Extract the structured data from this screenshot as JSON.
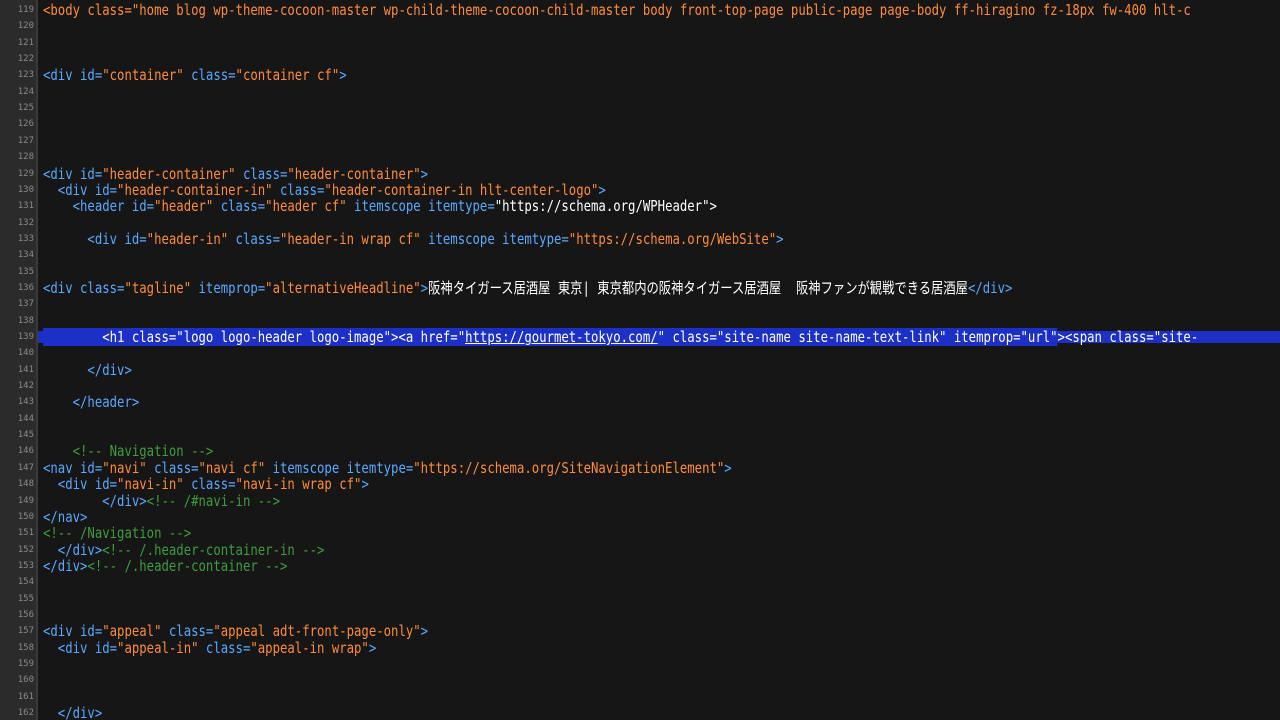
{
  "editor": {
    "line_numbers": [
      "119",
      "120",
      "121",
      "122",
      "123",
      "124",
      "125",
      "126",
      "127",
      "128",
      "129",
      "130",
      "131",
      "132",
      "133",
      "134",
      "135",
      "136",
      "137",
      "138",
      "139",
      "140",
      "141",
      "142",
      "143",
      "144",
      "145",
      "146",
      "147",
      "148",
      "149",
      "150",
      "151",
      "152",
      "153",
      "154",
      "155",
      "156",
      "157",
      "158",
      "159",
      "160",
      "161",
      "162"
    ],
    "lines": {
      "l119": "<body class=\"home blog wp-theme-cocoon-master wp-child-theme-cocoon-child-master body front-top-page public-page page-body ff-hiragino fz-18px fw-400 hlt-c",
      "l123": "<div id=\"container\" class=\"container cf\">",
      "l129": "<div id=\"header-container\" class=\"header-container\">",
      "l130": "  <div id=\"header-container-in\" class=\"header-container-in hlt-center-logo\">",
      "l131": "    <header id=\"header\" class=\"header cf\" itemscope itemtype=\"https://schema.org/WPHeader\">",
      "l133": "      <div id=\"header-in\" class=\"header-in wrap cf\" itemscope itemtype=\"https://schema.org/WebSite\">",
      "l136": "<div class=\"tagline\" itemprop=\"alternativeHeadline\">阪神タイガース居酒屋 東京| 東京都内の阪神タイガース居酒屋  阪神ファンが観戦できる居酒屋</div>",
      "l139": "        <h1 class=\"logo logo-header logo-image\"><a href=\"https://gourmet-tokyo.com/\" class=\"site-name site-name-text-link\" itemprop=\"url\"><span class=\"site-",
      "l141": "      </div>",
      "l143": "    </header>",
      "l146": "    <!-- Navigation -->",
      "l147": "<nav id=\"navi\" class=\"navi cf\" itemscope itemtype=\"https://schema.org/SiteNavigationElement\">",
      "l148": "  <div id=\"navi-in\" class=\"navi-in wrap cf\">",
      "l149": "        </div><!-- /#navi-in -->",
      "l150": "</nav>",
      "l151": "<!-- /Navigation -->",
      "l152": "  </div><!-- /.header-container-in -->",
      "l153": "</div><!-- /.header-container -->",
      "l157": "<div id=\"appeal\" class=\"appeal adt-front-page-only\">",
      "l158": "  <div id=\"appeal-in\" class=\"appeal-in wrap\">",
      "l162": "  </div>"
    },
    "tokens": {
      "l123": [
        "<div ",
        "id=",
        "\"container\"",
        " class=",
        "\"container cf\"",
        ">"
      ],
      "l129": [
        "<div ",
        "id=",
        "\"header-container\"",
        " class=",
        "\"header-container\"",
        ">"
      ],
      "l130": [
        "  <div ",
        "id=",
        "\"header-container-in\"",
        " class=",
        "\"header-container-in hlt-center-logo\"",
        ">"
      ],
      "l131": [
        "    <header ",
        "id=",
        "\"header\"",
        " class=",
        "\"header cf\"",
        " itemscope itemtype=",
        "\"https://schema.org/WPHeader\"",
        ">"
      ],
      "l133": [
        "      <div ",
        "id=",
        "\"header-in\"",
        " class=",
        "\"header-in wrap cf\"",
        " itemscope itemtype=",
        "\"https://schema.org/WebSite\"",
        ">"
      ],
      "l136": [
        "<div ",
        "class=",
        "\"tagline\"",
        " itemprop=",
        "\"alternativeHeadline\"",
        ">",
        "阪神タイガース居酒屋 東京| 東京都内の阪神タイガース居酒屋  阪神ファンが観戦できる居酒屋",
        "</div>"
      ],
      "l139": [
        "        <h1 class=\"logo logo-header logo-image\"><a href=\"",
        "https://gourmet-tokyo.com/",
        "\" class=\"site-name site-name-text-link\" itemprop=\"url\"><span class=\"site-"
      ],
      "l147": [
        "<nav ",
        "id=",
        "\"navi\"",
        " class=",
        "\"navi cf\"",
        " itemscope itemtype=",
        "\"https://schema.org/SiteNavigationElement\"",
        ">"
      ],
      "l148": [
        "  <div ",
        "id=",
        "\"navi-in\"",
        " class=",
        "\"navi-in wrap cf\"",
        ">"
      ],
      "l149": [
        "        </div>",
        "<!-- /#navi-in -->"
      ],
      "l152": [
        "  </div>",
        "<!-- /.header-container-in -->"
      ],
      "l153": [
        "</div>",
        "<!-- /.header-container -->"
      ],
      "l157": [
        "<div ",
        "id=",
        "\"appeal\"",
        " class=",
        "\"appeal adt-front-page-only\"",
        ">"
      ],
      "l158": [
        "  <div ",
        "id=",
        "\"appeal-in\"",
        " class=",
        "\"appeal-in wrap\"",
        ">"
      ]
    }
  }
}
